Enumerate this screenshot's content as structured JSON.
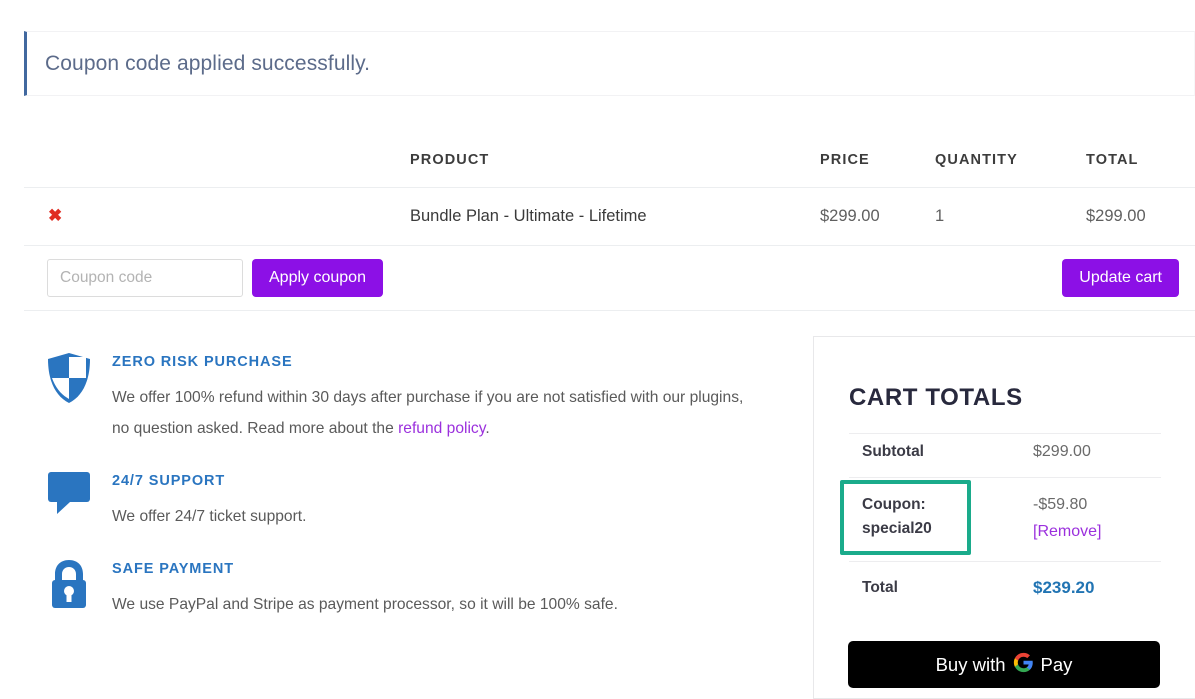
{
  "notice": {
    "message": "Coupon code applied successfully.",
    "accent_color": "#41689f"
  },
  "cart_table": {
    "headers": {
      "remove": "",
      "product": "PRODUCT",
      "price": "PRICE",
      "quantity": "QUANTITY",
      "total": "TOTAL"
    },
    "rows": [
      {
        "remove_icon": "✖",
        "product": "Bundle Plan - Ultimate - Lifetime",
        "price": "$299.00",
        "quantity": "1",
        "total": "$299.00"
      }
    ]
  },
  "coupon_form": {
    "input_placeholder": "Coupon code",
    "input_value": "",
    "apply_label": "Apply coupon",
    "update_label": "Update cart",
    "button_color": "#8c10e6"
  },
  "features": [
    {
      "icon": "shield-icon",
      "title": "ZERO RISK PURCHASE",
      "text_before_link": "We offer 100% refund within 30 days after purchase if you are not satisfied with our plugins, no question asked. Read more about the ",
      "link_text": "refund policy",
      "text_after_link": "."
    },
    {
      "icon": "speech-bubble-icon",
      "title": "24/7 SUPPORT",
      "text": "We offer 24/7 ticket support."
    },
    {
      "icon": "lock-icon",
      "title": "SAFE PAYMENT",
      "text": "We use PayPal and Stripe as payment processor, so it will be 100% safe."
    }
  ],
  "cart_totals": {
    "title": "CART TOTALS",
    "subtotal_label": "Subtotal",
    "subtotal_value": "$299.00",
    "coupon_label": "Coupon: special20",
    "coupon_value": "-$59.80",
    "coupon_remove_label": "[Remove]",
    "coupon_highlight_color": "#1aab8b",
    "total_label": "Total",
    "total_value": "$239.20",
    "total_value_color": "#2174b3"
  },
  "checkout": {
    "gpay_text_prefix": "Buy with",
    "gpay_text_suffix": "Pay",
    "gpay_icon": "google-g-icon"
  }
}
